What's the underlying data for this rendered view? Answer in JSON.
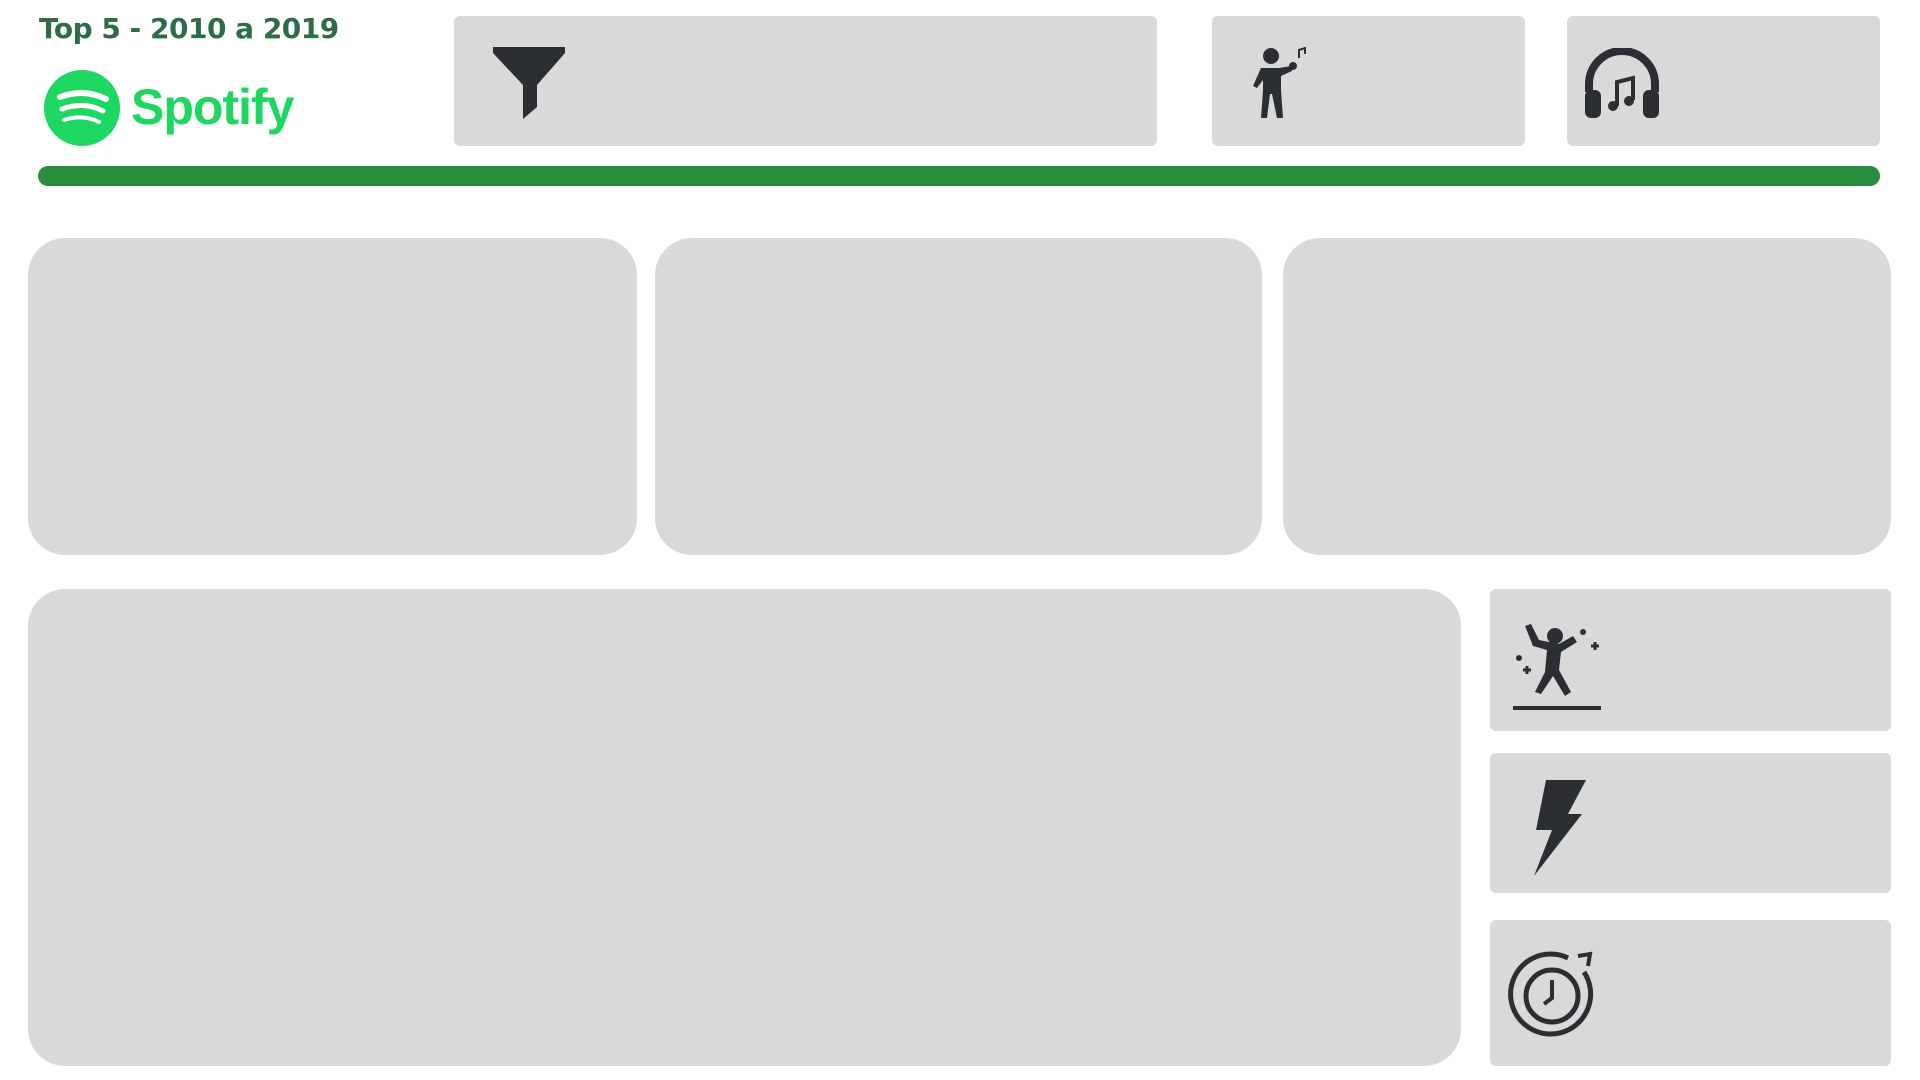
{
  "header": {
    "title": "Top 5 - 2010 a 2019",
    "logo_text": "Spotify",
    "accent_color": "#2a8c3f",
    "brand_color": "#1ed760"
  },
  "filters": [
    {
      "icon": "filter-icon"
    },
    {
      "icon": "singer-icon"
    },
    {
      "icon": "headphones-icon"
    }
  ],
  "kpis": [
    {
      "icon": "dancer-icon"
    },
    {
      "icon": "lightning-icon"
    },
    {
      "icon": "clock-icon"
    }
  ]
}
